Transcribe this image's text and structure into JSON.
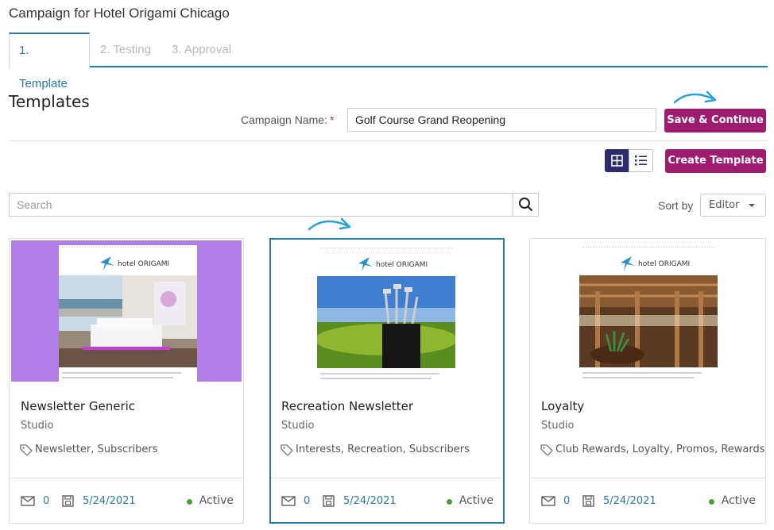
{
  "page_title": "Campaign for Hotel Origami Chicago",
  "tabs": [
    {
      "label": "1. Template",
      "active": true
    },
    {
      "label": "2. Testing",
      "active": false
    },
    {
      "label": "3. Approval",
      "active": false
    }
  ],
  "section_title": "Templates",
  "campaign_name": {
    "label": "Campaign Name:",
    "required_mark": "*",
    "value": "Golf Course Grand Reopening"
  },
  "save_button": "Save & Continue",
  "create_button": "Create Template",
  "search": {
    "placeholder": "Search"
  },
  "sort": {
    "label": "Sort by",
    "value": "Editor"
  },
  "colors": {
    "accent": "#2879a3",
    "primary_button": "#9e1c6f",
    "active_status": "#4e9b3c",
    "view_toggle_active": "#2f2a6b"
  },
  "cards": [
    {
      "title": "Newsletter Generic",
      "subtitle": "Studio",
      "tags": "Newsletter, Subscribers",
      "count": "0",
      "date": "5/24/2021",
      "status": "Active",
      "selected": false,
      "thumb_bg": "#b07ee6"
    },
    {
      "title": "Recreation Newsletter",
      "subtitle": "Studio",
      "tags": "Interests, Recreation, Subscribers",
      "count": "0",
      "date": "5/24/2021",
      "status": "Active",
      "selected": true,
      "thumb_bg": "#ffffff"
    },
    {
      "title": "Loyalty",
      "subtitle": "Studio",
      "tags": "Club Rewards, Loyalty, Promos, Rewards",
      "count": "0",
      "date": "5/24/2021",
      "status": "Active",
      "selected": false,
      "thumb_bg": "#ffffff"
    }
  ]
}
